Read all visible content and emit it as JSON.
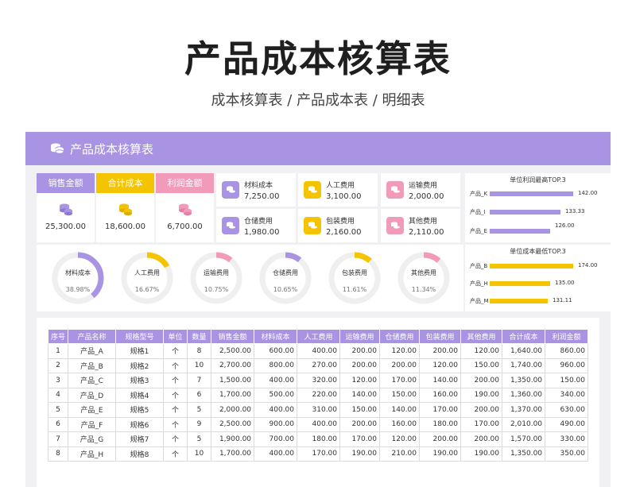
{
  "page": {
    "title": "产品成本核算表",
    "subtitle": "成本核算表 / 产品成本表 / 明细表"
  },
  "sheet": {
    "title": "产品成本核算表"
  },
  "colors": {
    "purple": "#a894e2",
    "yellow": "#f5c400",
    "pink": "#f29ab9"
  },
  "summary": [
    {
      "label": "销售金额",
      "value": "25,300.00",
      "color": "#a894e2",
      "icon": "coins-icon"
    },
    {
      "label": "合计成本",
      "value": "18,600.00",
      "color": "#f5c400",
      "icon": "coins-icon"
    },
    {
      "label": "利润金额",
      "value": "6,700.00",
      "color": "#f29ab9",
      "icon": "coins-icon"
    }
  ],
  "costs": [
    {
      "name": "材料成本",
      "value": "7,250.00",
      "color": "#a894e2"
    },
    {
      "name": "人工费用",
      "value": "3,100.00",
      "color": "#f5c400"
    },
    {
      "name": "运输费用",
      "value": "2,000.00",
      "color": "#f29ab9"
    },
    {
      "name": "仓储费用",
      "value": "1,980.00",
      "color": "#a894e2"
    },
    {
      "name": "包装费用",
      "value": "2,160.00",
      "color": "#f5c400"
    },
    {
      "name": "其他费用",
      "value": "2,110.00",
      "color": "#f29ab9"
    }
  ],
  "rings": [
    {
      "name": "材料成本",
      "percent": "38.98%",
      "fraction": 0.3898,
      "color": "#a894e2"
    },
    {
      "name": "人工费用",
      "percent": "16.67%",
      "fraction": 0.1667,
      "color": "#f5c400"
    },
    {
      "name": "运输费用",
      "percent": "10.75%",
      "fraction": 0.1075,
      "color": "#f29ab9"
    },
    {
      "name": "仓储费用",
      "percent": "10.65%",
      "fraction": 0.1065,
      "color": "#a894e2"
    },
    {
      "name": "包装费用",
      "percent": "11.61%",
      "fraction": 0.1161,
      "color": "#f5c400"
    },
    {
      "name": "其他费用",
      "percent": "11.34%",
      "fraction": 0.1134,
      "color": "#f29ab9"
    }
  ],
  "top_rank": {
    "title": "单位利润最高TOP.3",
    "color": "#a894e2",
    "items": [
      {
        "label": "产品_K",
        "value": "142.00",
        "num": 142
      },
      {
        "label": "产品_I",
        "value": "133.33",
        "num": 133.33
      },
      {
        "label": "产品_E",
        "value": "126.00",
        "num": 126
      }
    ]
  },
  "low_rank": {
    "title": "单位成本最低TOP.3",
    "color": "#f5c400",
    "items": [
      {
        "label": "产品_B",
        "value": "174.00",
        "num": 174
      },
      {
        "label": "产品_H",
        "value": "135.00",
        "num": 135
      },
      {
        "label": "产品_M",
        "value": "131.11",
        "num": 131.11
      }
    ]
  },
  "table": {
    "headers": [
      "序号",
      "产品名称",
      "规格型号",
      "单位",
      "数量",
      "销售金额",
      "材料成本",
      "人工费用",
      "运输费用",
      "仓储费用",
      "包装费用",
      "其他费用",
      "合计成本",
      "利润金额"
    ],
    "rows": [
      [
        "1",
        "产品_A",
        "规格1",
        "个",
        "8",
        "2,500.00",
        "600.00",
        "400.00",
        "200.00",
        "120.00",
        "200.00",
        "120.00",
        "1,640.00",
        "860.00"
      ],
      [
        "2",
        "产品_B",
        "规格2",
        "个",
        "10",
        "2,700.00",
        "800.00",
        "270.00",
        "200.00",
        "200.00",
        "120.00",
        "150.00",
        "1,740.00",
        "960.00"
      ],
      [
        "3",
        "产品_C",
        "规格3",
        "个",
        "7",
        "1,500.00",
        "400.00",
        "320.00",
        "120.00",
        "170.00",
        "140.00",
        "200.00",
        "1,350.00",
        "150.00"
      ],
      [
        "4",
        "产品_D",
        "规格4",
        "个",
        "6",
        "1,700.00",
        "500.00",
        "220.00",
        "140.00",
        "150.00",
        "160.00",
        "190.00",
        "1,360.00",
        "340.00"
      ],
      [
        "5",
        "产品_E",
        "规格5",
        "个",
        "5",
        "2,000.00",
        "400.00",
        "310.00",
        "150.00",
        "140.00",
        "170.00",
        "200.00",
        "1,370.00",
        "630.00"
      ],
      [
        "6",
        "产品_F",
        "规格6",
        "个",
        "9",
        "2,500.00",
        "900.00",
        "400.00",
        "200.00",
        "160.00",
        "180.00",
        "170.00",
        "2,010.00",
        "490.00"
      ],
      [
        "7",
        "产品_G",
        "规格7",
        "个",
        "5",
        "1,900.00",
        "700.00",
        "180.00",
        "170.00",
        "120.00",
        "200.00",
        "200.00",
        "1,570.00",
        "330.00"
      ],
      [
        "8",
        "产品_H",
        "规格8",
        "个",
        "10",
        "1,700.00",
        "400.00",
        "170.00",
        "190.00",
        "210.00",
        "190.00",
        "190.00",
        "1,350.00",
        "350.00"
      ]
    ]
  }
}
